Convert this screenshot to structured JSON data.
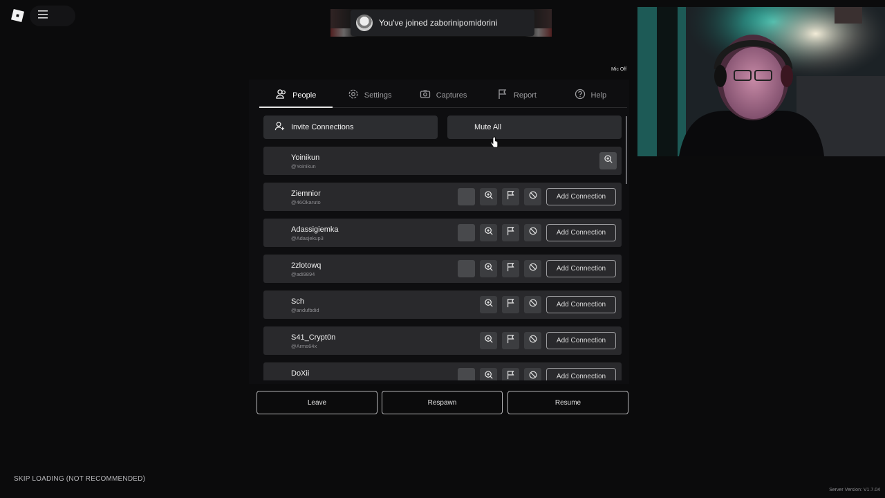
{
  "toast": {
    "message": "You've joined zaborinipomidorini"
  },
  "mic_status": "Mic Off",
  "tabs": [
    {
      "label": "People",
      "icon": "people-icon",
      "active": true
    },
    {
      "label": "Settings",
      "icon": "gear-icon",
      "active": false
    },
    {
      "label": "Captures",
      "icon": "camera-icon",
      "active": false
    },
    {
      "label": "Report",
      "icon": "flag-icon",
      "active": false
    },
    {
      "label": "Help",
      "icon": "help-icon",
      "active": false
    }
  ],
  "actions": {
    "invite_label": "Invite Connections",
    "mute_all_label": "Mute All"
  },
  "add_connection_label": "Add Connection",
  "players": [
    {
      "name": "Yoinikun",
      "handle": "@Yoinikun"
    },
    {
      "name": "Ziemnior",
      "handle": "@46Okaruto"
    },
    {
      "name": "Adassigiemka",
      "handle": "@Adasjekup3"
    },
    {
      "name": "2zlotowq",
      "handle": "@adi9894"
    },
    {
      "name": "Sch",
      "handle": "@andufbdid"
    },
    {
      "name": "S41_Crypt0n",
      "handle": "@Arms64x"
    },
    {
      "name": "DoXii",
      "handle": ""
    }
  ],
  "bottom": {
    "leave_label": "Leave",
    "respawn_label": "Respawn",
    "resume_label": "Resume"
  },
  "skip_loading": "SKIP LOADING (NOT RECOMMENDED)",
  "server_version": "Server Version: V1.7.04"
}
